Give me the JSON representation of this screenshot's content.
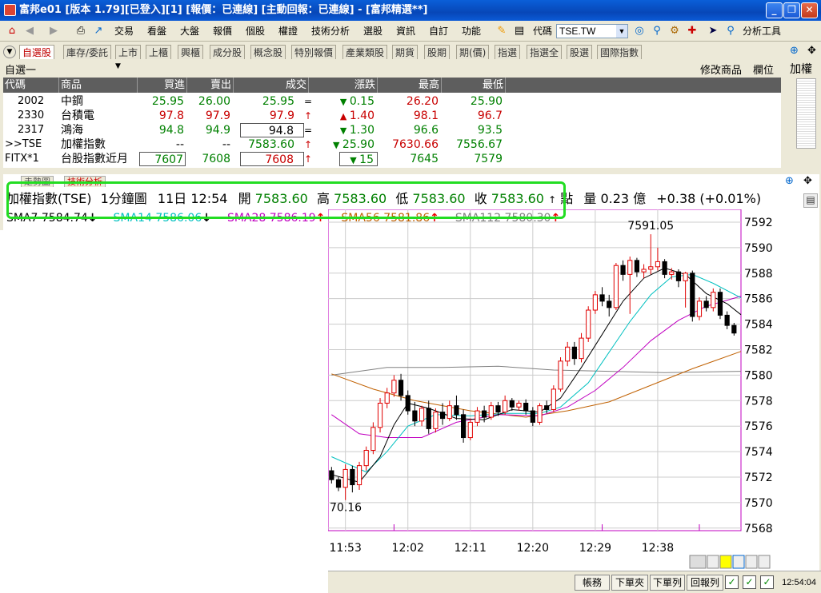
{
  "window": {
    "title": "富邦e01 [版本 1.79][已登入][1] [報價：已連線] [主動回報：已連線] - [富邦精選**]"
  },
  "menu": {
    "items": [
      "交易",
      "看盤",
      "大盤",
      "報價",
      "個股",
      "權證",
      "技術分析",
      "選股",
      "資訊",
      "自訂",
      "功能"
    ],
    "code_label": "代碼",
    "code_value": "TSE.TW",
    "analysis_tools": "分析工具"
  },
  "tabs": [
    "自選股",
    "庫存/委託",
    "上市",
    "上櫃",
    "興櫃",
    "成分股",
    "概念股",
    "特別報價",
    "產業類股",
    "期貨",
    "股期",
    "期(價)",
    "指選",
    "指選全",
    "股選",
    "國際指數"
  ],
  "watchlist": {
    "selector": "自選一",
    "edit_label": "修改商品",
    "columns_label": "欄位",
    "side_label": "加權"
  },
  "columns": [
    "代碼",
    "商品",
    "買進",
    "賣出",
    "成交",
    "漲跌",
    "最高",
    "最低"
  ],
  "quotes": [
    {
      "code": "2002",
      "name": "中鋼",
      "bid": "25.95",
      "ask": "26.00",
      "last": "25.95",
      "last_mark": "=",
      "change": "0.15",
      "dir": "down",
      "high": "26.20",
      "low": "25.90"
    },
    {
      "code": "2330",
      "name": "台積電",
      "bid": "97.8",
      "ask": "97.9",
      "last": "97.9",
      "last_mark": "↑",
      "change": "1.40",
      "dir": "up",
      "high": "98.1",
      "low": "96.7"
    },
    {
      "code": "2317",
      "name": "鴻海",
      "bid": "94.8",
      "ask": "94.9",
      "last": "94.8",
      "last_mark": "=",
      "change": "1.30",
      "dir": "down",
      "high": "96.6",
      "low": "93.5"
    },
    {
      "code": ">>TSE",
      "name": "加權指數",
      "bid": "--",
      "ask": "--",
      "last": "7583.60",
      "last_mark": "↑",
      "change": "25.90",
      "dir": "down",
      "high": "7630.66",
      "low": "7556.67"
    },
    {
      "code": "FITX*1",
      "name": "台股指數近月",
      "bid": "7607",
      "ask": "7608",
      "last": "7608",
      "last_mark": "↑",
      "change": "15",
      "dir": "down",
      "high": "7645",
      "low": "7579"
    }
  ],
  "chart_tabs": [
    "走勢圖",
    "技術分析"
  ],
  "info": {
    "symbol": "加權指數(TSE)",
    "period": "1分鐘圖",
    "date_time": "11日 12:54",
    "open_label": "開",
    "open": "7583.60",
    "high_label": "高",
    "high": "7583.60",
    "low_label": "低",
    "low": "7583.60",
    "close_label": "收",
    "close": "7583.60",
    "tick_label": "點",
    "volume_label": "量",
    "volume": "0.23",
    "volume_unit": "億",
    "change": "+0.38",
    "change_pct": "(+0.01%)"
  },
  "ma_labels": [
    {
      "text": "SMA7 7584.74",
      "arrow": "↓",
      "color": "#000000"
    },
    {
      "text": "SMA14 7586.06",
      "arrow": "↓",
      "color": "#00c0c0"
    },
    {
      "text": "SMA28 7586.19",
      "arrow": "↑",
      "color": "#c000c0"
    },
    {
      "text": "SMA56 7581.86",
      "arrow": "↑",
      "color": "#c06000"
    },
    {
      "text": "SMA112 7580.30",
      "arrow": "↑",
      "color": "#808080"
    }
  ],
  "chart_data": {
    "type": "candlestick",
    "y_ticks": [
      7568,
      7570,
      7572,
      7574,
      7576,
      7578,
      7580,
      7582,
      7584,
      7586,
      7588,
      7590,
      7592
    ],
    "ylim": [
      7567.8,
      7593
    ],
    "x_ticks": [
      "11:53",
      "12:02",
      "12:11",
      "12:20",
      "12:29",
      "12:38"
    ],
    "high_annotation": "7591.05",
    "low_annotation": "70.16",
    "colors": {
      "up": "#e00000",
      "down": "#000000",
      "sma7": "#000000",
      "sma14": "#00c0c0",
      "sma28": "#c000c0",
      "sma56": "#c06000",
      "sma112": "#808080"
    },
    "ohlc": [
      [
        7572.5,
        7572.8,
        7571.5,
        7571.8
      ],
      [
        7571.8,
        7572.0,
        7570.9,
        7571.2
      ],
      [
        7571.2,
        7573.0,
        7570.2,
        7572.6
      ],
      [
        7572.6,
        7572.9,
        7570.8,
        7571.4
      ],
      [
        7571.4,
        7573.2,
        7571.0,
        7572.9
      ],
      [
        7572.9,
        7574.4,
        7572.5,
        7574.1
      ],
      [
        7574.1,
        7576.3,
        7573.8,
        7575.9
      ],
      [
        7575.9,
        7578.2,
        7575.5,
        7577.8
      ],
      [
        7577.8,
        7579.0,
        7577.4,
        7578.6
      ],
      [
        7578.6,
        7580.0,
        7578.3,
        7579.6
      ],
      [
        7579.6,
        7580.1,
        7578.0,
        7578.4
      ],
      [
        7578.4,
        7578.8,
        7576.9,
        7577.2
      ],
      [
        7577.2,
        7577.9,
        7576.0,
        7576.4
      ],
      [
        7576.4,
        7577.6,
        7576.0,
        7577.4
      ],
      [
        7577.4,
        7578.0,
        7575.4,
        7575.8
      ],
      [
        7575.8,
        7577.4,
        7575.5,
        7577.1
      ],
      [
        7577.1,
        7577.8,
        7576.1,
        7576.6
      ],
      [
        7576.6,
        7578.0,
        7576.4,
        7577.6
      ],
      [
        7577.6,
        7578.4,
        7576.5,
        7576.9
      ],
      [
        7576.9,
        7577.3,
        7574.7,
        7575.1
      ],
      [
        7575.1,
        7576.6,
        7574.9,
        7576.3
      ],
      [
        7576.3,
        7577.5,
        7576.0,
        7577.2
      ],
      [
        7577.2,
        7577.6,
        7576.3,
        7576.7
      ],
      [
        7576.7,
        7577.9,
        7576.5,
        7577.6
      ],
      [
        7577.6,
        7577.9,
        7576.8,
        7577.1
      ],
      [
        7577.1,
        7578.4,
        7576.9,
        7578.0
      ],
      [
        7578.0,
        7578.2,
        7577.2,
        7577.5
      ],
      [
        7577.5,
        7578.0,
        7577.2,
        7577.8
      ],
      [
        7577.8,
        7578.1,
        7576.9,
        7577.2
      ],
      [
        7577.2,
        7577.5,
        7576.0,
        7576.3
      ],
      [
        7576.3,
        7577.8,
        7576.1,
        7577.6
      ],
      [
        7577.6,
        7578.0,
        7577.0,
        7577.3
      ],
      [
        7577.3,
        7579.2,
        7577.1,
        7578.9
      ],
      [
        7578.9,
        7581.4,
        7578.7,
        7581.1
      ],
      [
        7581.1,
        7582.6,
        7580.7,
        7582.2
      ],
      [
        7582.2,
        7582.6,
        7580.8,
        7581.3
      ],
      [
        7581.3,
        7583.3,
        7581.0,
        7582.9
      ],
      [
        7582.9,
        7585.4,
        7582.6,
        7585.1
      ],
      [
        7585.1,
        7586.6,
        7584.8,
        7586.3
      ],
      [
        7586.3,
        7586.9,
        7585.4,
        7585.8
      ],
      [
        7585.8,
        7586.3,
        7584.6,
        7585.3
      ],
      [
        7585.3,
        7588.8,
        7585.1,
        7588.6
      ],
      [
        7588.6,
        7589.0,
        7587.4,
        7587.9
      ],
      [
        7587.9,
        7589.3,
        7584.8,
        7589.0
      ],
      [
        7589.0,
        7589.2,
        7587.7,
        7588.1
      ],
      [
        7588.1,
        7588.7,
        7587.6,
        7588.3
      ],
      [
        7588.3,
        7591.05,
        7587.9,
        7588.5
      ],
      [
        7588.5,
        7590.0,
        7588.2,
        7588.9
      ],
      [
        7588.9,
        7589.1,
        7587.6,
        7587.9
      ],
      [
        7587.9,
        7588.4,
        7587.5,
        7588.1
      ],
      [
        7588.1,
        7588.3,
        7586.9,
        7587.4
      ],
      [
        7587.4,
        7588.1,
        7585.3,
        7588.0
      ],
      [
        7588.0,
        7588.2,
        7584.2,
        7584.6
      ],
      [
        7584.6,
        7586.1,
        7584.3,
        7585.8
      ],
      [
        7585.8,
        7586.2,
        7585.0,
        7585.3
      ],
      [
        7585.3,
        7586.8,
        7585.0,
        7586.5
      ],
      [
        7586.5,
        7586.8,
        7584.4,
        7584.7
      ],
      [
        7584.7,
        7585.0,
        7583.6,
        7583.9
      ],
      [
        7583.9,
        7584.1,
        7583.1,
        7583.3
      ]
    ],
    "sma7": [
      [
        0,
        7572.2
      ],
      [
        4,
        7571.6
      ],
      [
        7,
        7573.6
      ],
      [
        9,
        7576.1
      ],
      [
        11,
        7577.8
      ],
      [
        14,
        7577.4
      ],
      [
        18,
        7576.6
      ],
      [
        22,
        7576.5
      ],
      [
        26,
        7577.3
      ],
      [
        30,
        7577.1
      ],
      [
        33,
        7578.2
      ],
      [
        36,
        7580.6
      ],
      [
        39,
        7583.2
      ],
      [
        42,
        7585.8
      ],
      [
        45,
        7587.6
      ],
      [
        48,
        7588.4
      ],
      [
        51,
        7587.9
      ],
      [
        54,
        7586.4
      ],
      [
        57,
        7585.6
      ],
      [
        59,
        7584.74
      ]
    ],
    "sma14": [
      [
        0,
        7573.6
      ],
      [
        5,
        7572.4
      ],
      [
        8,
        7574.0
      ],
      [
        11,
        7576.0
      ],
      [
        15,
        7576.9
      ],
      [
        20,
        7576.8
      ],
      [
        25,
        7577.0
      ],
      [
        30,
        7577.0
      ],
      [
        33,
        7577.5
      ],
      [
        37,
        7579.4
      ],
      [
        40,
        7581.8
      ],
      [
        43,
        7584.2
      ],
      [
        46,
        7586.3
      ],
      [
        49,
        7587.7
      ],
      [
        52,
        7587.9
      ],
      [
        55,
        7587.2
      ],
      [
        59,
        7586.06
      ]
    ],
    "sma28": [
      [
        0,
        7576.9
      ],
      [
        4,
        7575.4
      ],
      [
        8,
        7575.1
      ],
      [
        13,
        7575.1
      ],
      [
        18,
        7576.3
      ],
      [
        24,
        7576.9
      ],
      [
        30,
        7576.8
      ],
      [
        34,
        7577.5
      ],
      [
        38,
        7578.8
      ],
      [
        42,
        7580.6
      ],
      [
        46,
        7582.7
      ],
      [
        50,
        7584.3
      ],
      [
        54,
        7585.4
      ],
      [
        59,
        7586.19
      ]
    ],
    "sma56": [
      [
        0,
        7580.1
      ],
      [
        6,
        7578.9
      ],
      [
        12,
        7578.0
      ],
      [
        20,
        7577.2
      ],
      [
        28,
        7576.7
      ],
      [
        34,
        7577.2
      ],
      [
        40,
        7577.9
      ],
      [
        46,
        7579.2
      ],
      [
        52,
        7580.5
      ],
      [
        59,
        7581.86
      ]
    ],
    "sma112": [
      [
        0,
        7580.0
      ],
      [
        8,
        7580.6
      ],
      [
        16,
        7580.6
      ],
      [
        24,
        7580.7
      ],
      [
        32,
        7580.4
      ],
      [
        40,
        7580.3
      ],
      [
        48,
        7580.2
      ],
      [
        59,
        7580.3
      ]
    ],
    "volume_ticks": [
      9,
      39,
      53
    ]
  },
  "status": {
    "buttons": [
      "帳務",
      "下單夾",
      "下單列",
      "回報列"
    ],
    "clock": "12:54:04"
  }
}
